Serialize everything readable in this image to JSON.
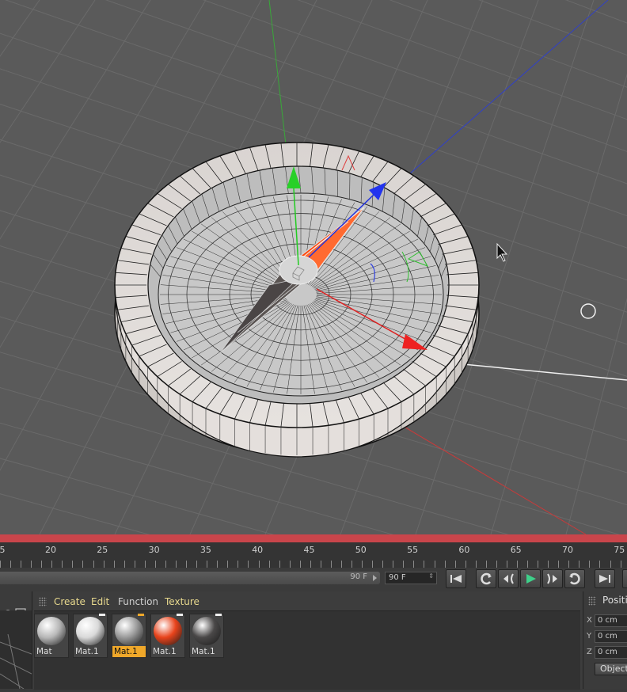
{
  "timeline": {
    "ticks": [
      "5",
      "20",
      "25",
      "30",
      "35",
      "40",
      "45",
      "50",
      "55",
      "60",
      "65",
      "70",
      "75"
    ]
  },
  "transport": {
    "current_frame": "90 F",
    "end_frame": "90 F",
    "buttons": {
      "go_start": "go-to-start-icon",
      "prev_key": "previous-key-icon",
      "prev_frame": "previous-frame-icon",
      "play": "play-icon",
      "next_frame": "next-frame-icon",
      "next_key": "next-key-icon",
      "go_end": "go-to-end-icon"
    },
    "play_color": "#3ed08a"
  },
  "materials": {
    "menu": [
      "Create",
      "Edit",
      "Function",
      "Texture"
    ],
    "items": [
      {
        "label": "Mat",
        "color": "#b8b8b8",
        "selected": false
      },
      {
        "label": "Mat.1",
        "color": "#d9d9d9",
        "selected": false
      },
      {
        "label": "Mat.1",
        "color": "#9a9a9a",
        "selected": true
      },
      {
        "label": "Mat.1",
        "color": "#e8431b",
        "selected": false
      },
      {
        "label": "Mat.1",
        "color": "#4a4848",
        "selected": false
      }
    ]
  },
  "attributes": {
    "title": "Position",
    "x_label": "X",
    "x_value": "0 cm",
    "y_label": "Y",
    "y_value": "0 cm",
    "z_label": "Z",
    "z_value": "0 cm",
    "mode_button": "Object"
  },
  "colors": {
    "viewport_bg": "#5a5a5a",
    "axis_x": "#e03030",
    "axis_y": "#30c030",
    "axis_z": "#3040e0",
    "needle_north": "#ff4a10",
    "needle_south": "#555050",
    "selection_label": "#f0a82a"
  }
}
